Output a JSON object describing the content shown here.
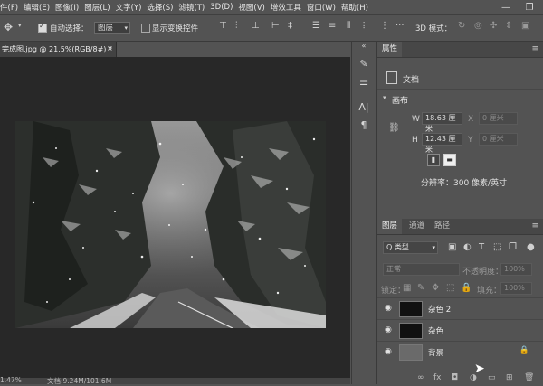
{
  "menu": [
    "件(F)",
    "编辑(E)",
    "图像(I)",
    "图层(L)",
    "文字(Y)",
    "选择(S)",
    "滤镜(T)",
    "3D(D)",
    "视图(V)",
    "增效工具",
    "窗口(W)",
    "帮助(H)"
  ],
  "window_controls": {
    "minimize": "—",
    "maximize": "❐"
  },
  "options": {
    "auto_select_label": "自动选择：",
    "auto_select_value": "图层",
    "show_transform_label": "显示变换控件",
    "mode_3d_label": "3D 模式："
  },
  "document": {
    "tab_title": "完成图.jpg @ 21.5%(RGB/8#) *",
    "tab_close": "×",
    "status_zoom": "1.47%",
    "status_doc": "文档:9.24M/101.6M"
  },
  "properties": {
    "tab_label": "属性",
    "doc_label": "文档",
    "canvas_section": "画布",
    "w_label": "W",
    "w_value": "18.63 厘米",
    "x_label": "X",
    "x_value": "0 厘米",
    "h_label": "H",
    "h_value": "12.43 厘米",
    "y_label": "Y",
    "y_value": "0 厘米",
    "resolution": "分辨率：300 像素/英寸"
  },
  "layers_panel": {
    "tabs": [
      "图层",
      "通道",
      "路径"
    ],
    "kind_label": "Q 类型",
    "blend_mode": "正常",
    "opacity_label": "不透明度：",
    "opacity_value": "100%",
    "lock_label": "锁定：",
    "fill_label": "填充：",
    "fill_value": "100%",
    "layers": [
      {
        "name": "杂色 2",
        "visible": true
      },
      {
        "name": "杂色",
        "visible": true
      },
      {
        "name": "背景",
        "visible": true,
        "locked": true
      }
    ]
  },
  "colors": {
    "ui_bg": "#535353",
    "canvas_bg": "#282828",
    "panel_dark": "#474747"
  }
}
